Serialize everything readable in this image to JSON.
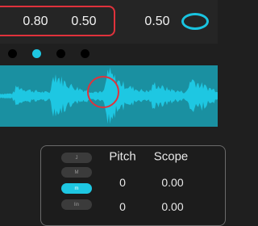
{
  "top_bar": {
    "values": [
      "0.80",
      "0.50"
    ],
    "right_value": "0.50",
    "accent_color": "#e0323c",
    "button_color": "#1ec7e2",
    "oval_icon": "oval-toggle-icon"
  },
  "page_dots": {
    "count": 4,
    "active_index": 1
  },
  "waveform": {
    "color": "#1ec7e2",
    "background": "#1a90a1"
  },
  "mode_selector": {
    "options": [
      "J",
      "M",
      "m",
      "lin"
    ],
    "active_index": 2
  },
  "params_table": {
    "headers": [
      "Pitch",
      "Scope"
    ],
    "rows": [
      [
        "0",
        "0.00"
      ],
      [
        "0",
        "0.00"
      ]
    ]
  }
}
